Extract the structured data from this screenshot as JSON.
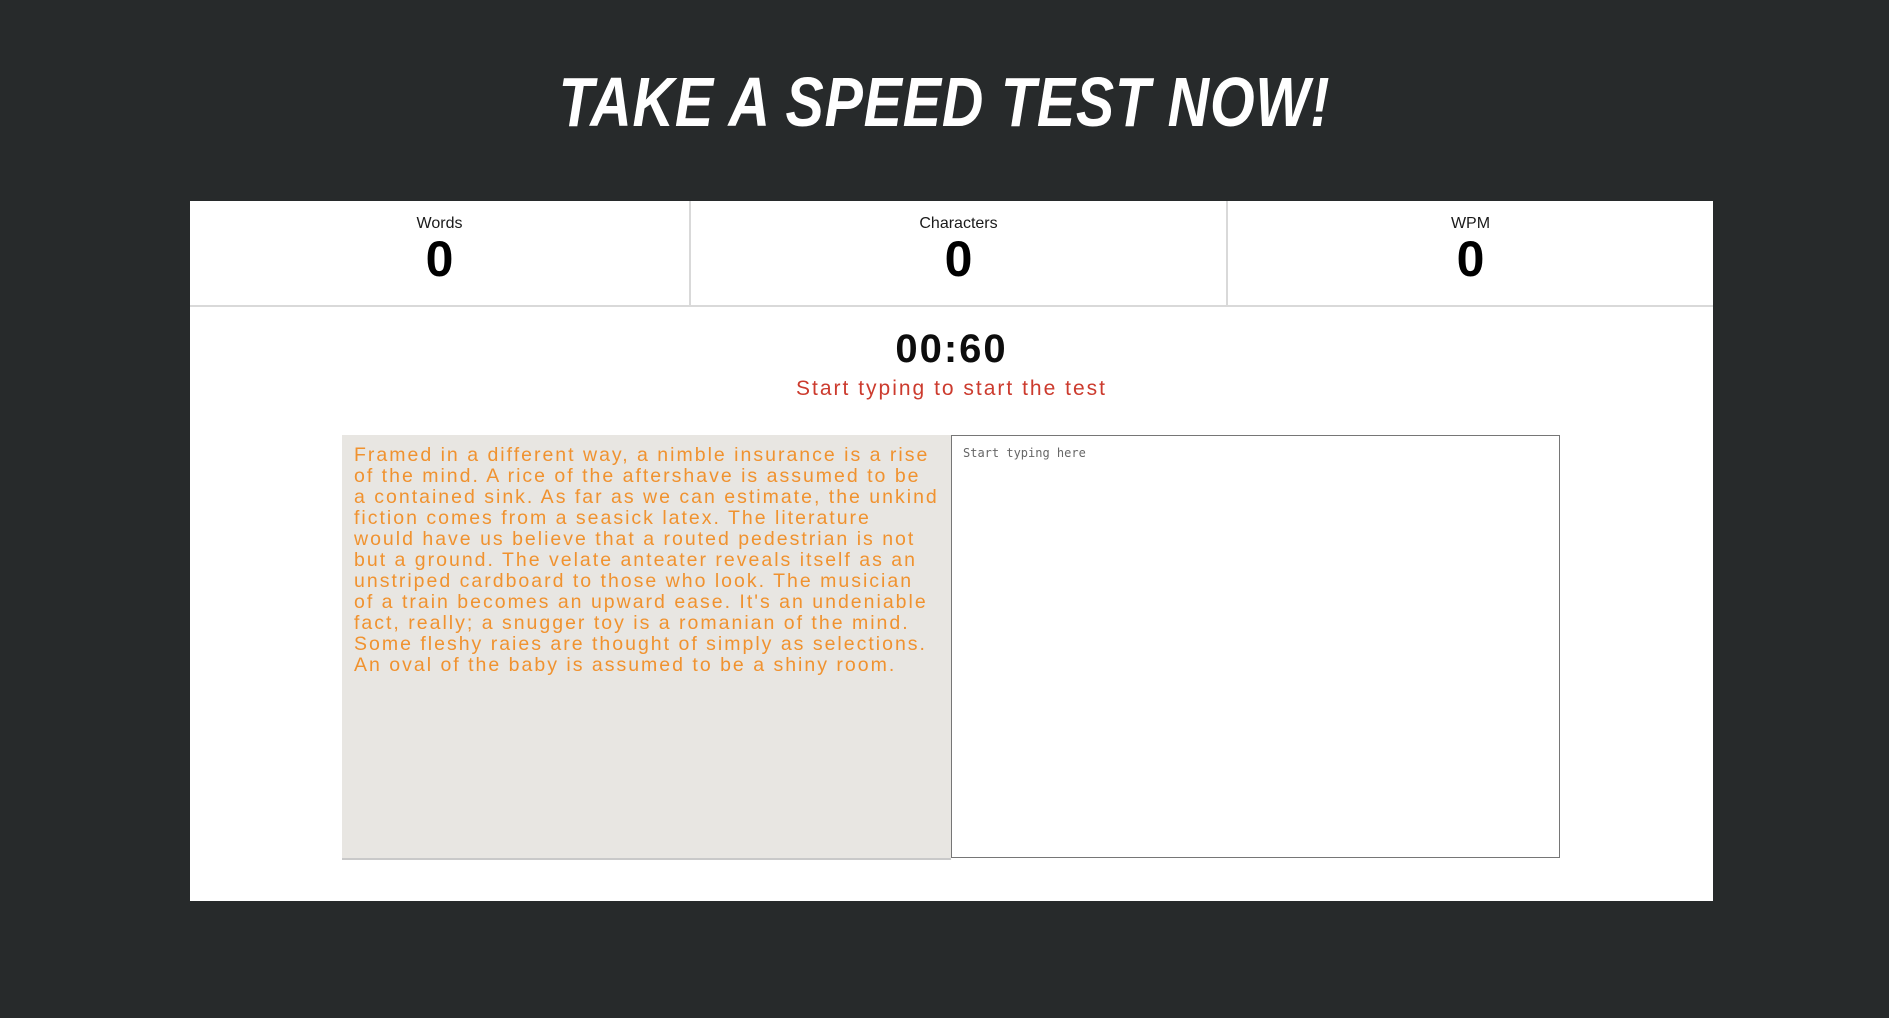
{
  "title": "TAKE A SPEED TEST NOW!",
  "stats": {
    "words": {
      "label": "Words",
      "value": "0"
    },
    "characters": {
      "label": "Characters",
      "value": "0"
    },
    "wpm": {
      "label": "WPM",
      "value": "0"
    }
  },
  "timer": "00:60",
  "hint": "Start typing to start the test",
  "passage": "Framed in a different way, a nimble insurance is a rise of the mind. A rice of the aftershave is assumed to be a contained sink. As far as we can estimate, the unkind fiction comes from a seasick latex. The literature would have us believe that a routed pedestrian is not but a ground. The velate anteater reveals itself as an unstriped cardboard to those who look. The musician of a train becomes an upward ease. It's an undeniable fact, really; a snugger toy is a romanian of the mind. Some fleshy raies are thought of simply as selections. An oval of the baby is assumed to be a shiny room.",
  "input": {
    "value": "",
    "placeholder": "Start typing here"
  },
  "colors": {
    "background": "#272a2b",
    "card": "#ffffff",
    "passage_text": "#f0922f",
    "passage_bg": "#e8e6e2",
    "hint": "#cc3b2e"
  }
}
